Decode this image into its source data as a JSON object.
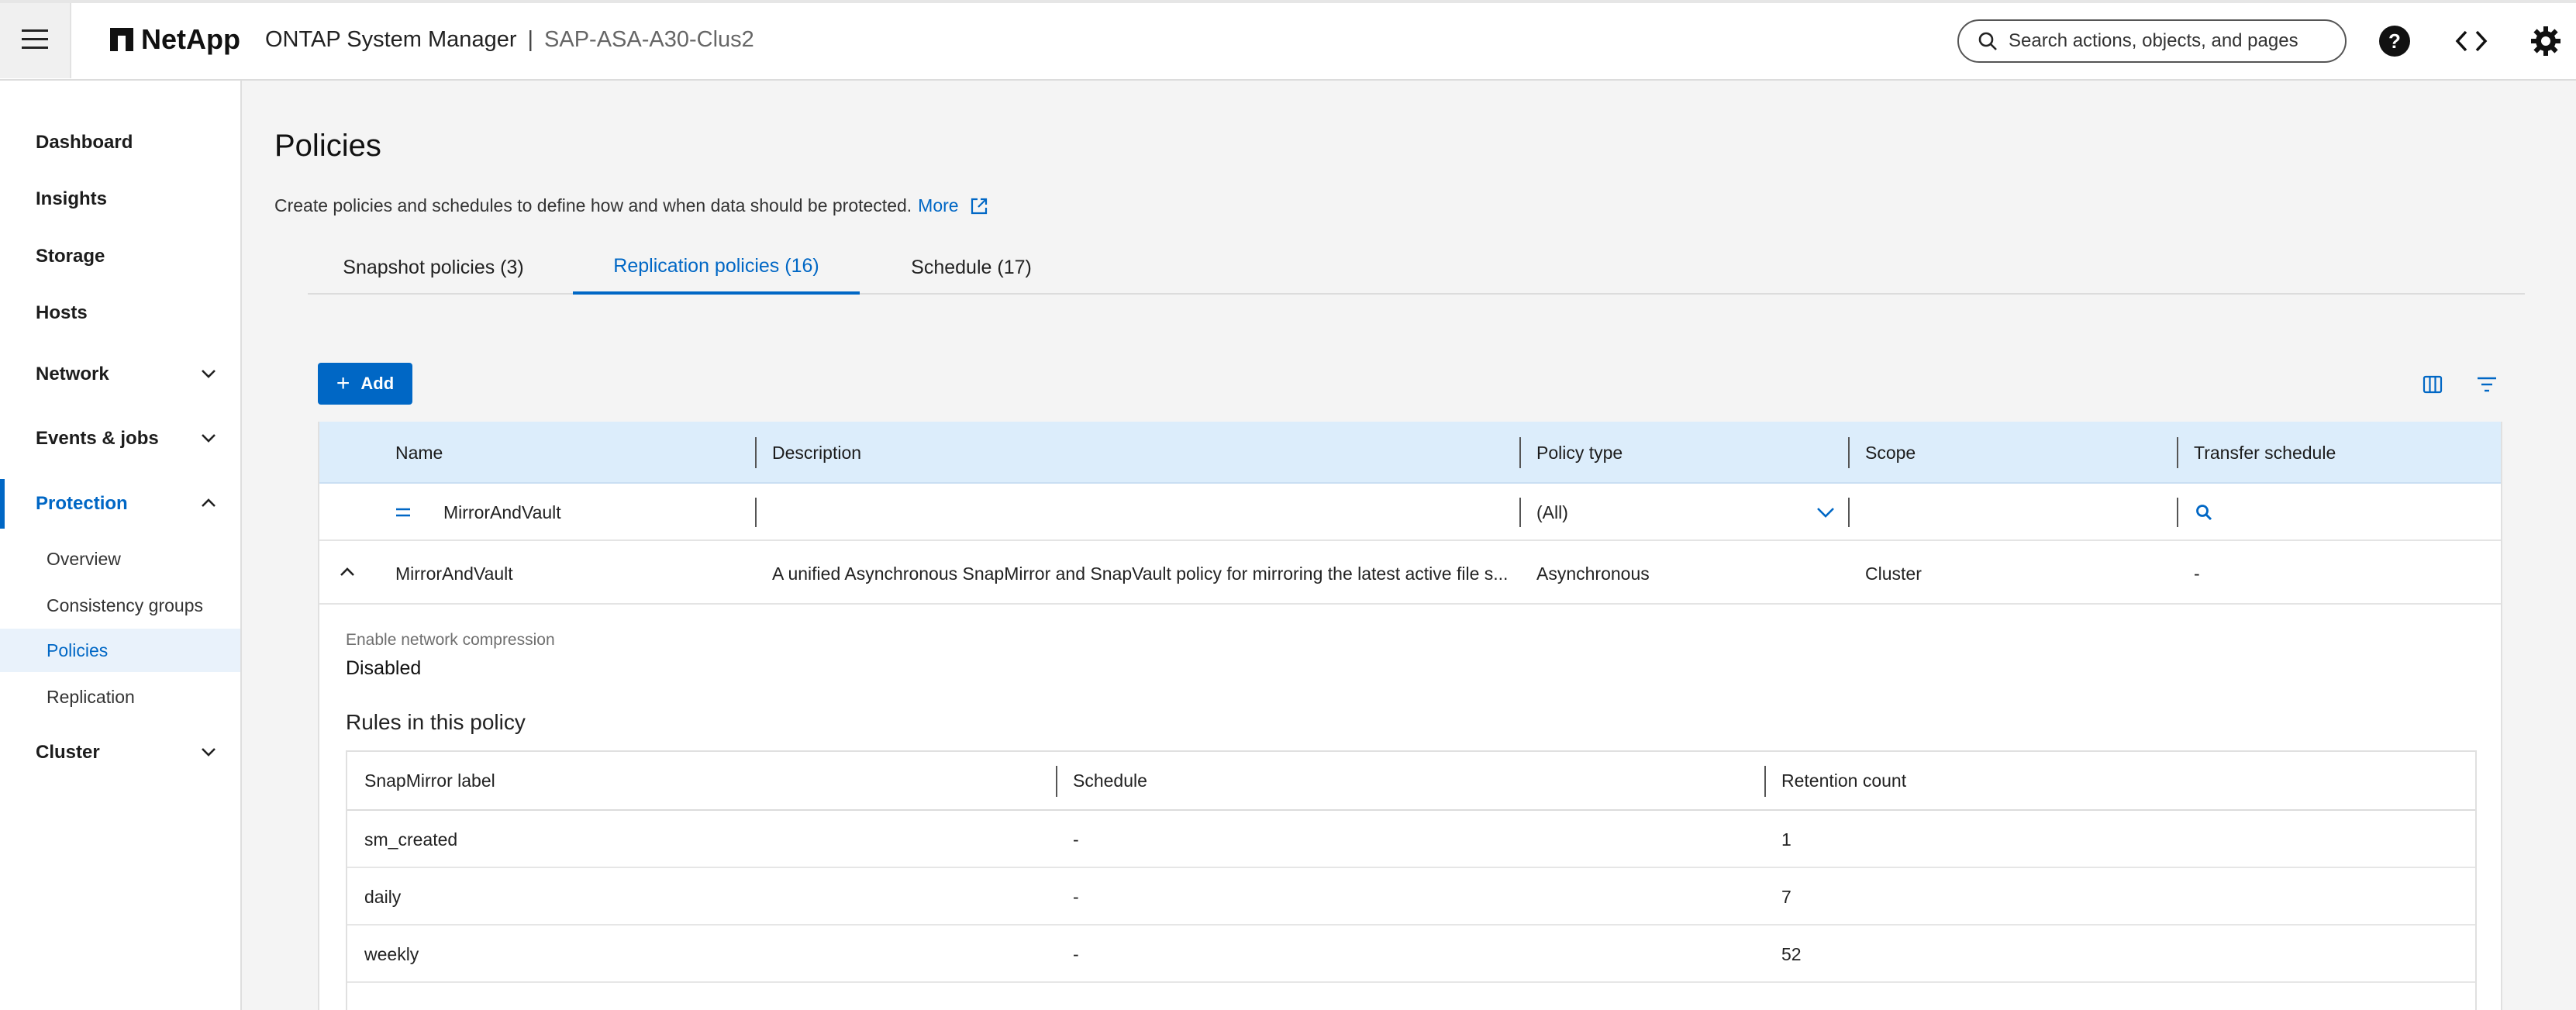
{
  "header": {
    "brand": "NetApp",
    "app_title": "ONTAP System Manager",
    "separator": "|",
    "cluster": "SAP-ASA-A30-Clus2",
    "search_placeholder": "Search actions, objects, and pages",
    "icons": [
      "hamburger-icon",
      "help-icon",
      "code-icon",
      "settings-icon"
    ]
  },
  "sidebar": {
    "items": [
      {
        "label": "Dashboard"
      },
      {
        "label": "Insights"
      },
      {
        "label": "Storage"
      },
      {
        "label": "Hosts"
      },
      {
        "label": "Network",
        "expandable": true
      },
      {
        "label": "Events & jobs",
        "expandable": true
      },
      {
        "label": "Protection",
        "expandable": true,
        "expanded": true,
        "active": true
      },
      {
        "label": "Cluster",
        "expandable": true
      }
    ],
    "protection_sub": [
      {
        "label": "Overview"
      },
      {
        "label": "Consistency groups"
      },
      {
        "label": "Policies",
        "active": true
      },
      {
        "label": "Replication"
      }
    ]
  },
  "page": {
    "title": "Policies",
    "description": "Create policies and schedules to define how and when data should be protected.",
    "more_link": "More"
  },
  "tabs": [
    {
      "label": "Snapshot policies (3)"
    },
    {
      "label": "Replication policies (16)",
      "active": true
    },
    {
      "label": "Schedule (17)"
    }
  ],
  "toolbar": {
    "add_label": "Add"
  },
  "grid": {
    "columns": [
      "Name",
      "Description",
      "Policy type",
      "Scope",
      "Transfer schedule"
    ],
    "filters": {
      "name_operator": "=",
      "name_value": "MirrorAndVault",
      "policy_type": "(All)"
    },
    "rows": [
      {
        "name": "MirrorAndVault",
        "description": "A unified Asynchronous SnapMirror and SnapVault policy for mirroring the latest active file s...",
        "policy_type": "Asynchronous",
        "scope": "Cluster",
        "transfer_schedule": "-"
      }
    ]
  },
  "details": {
    "compression_label": "Enable network compression",
    "compression_value": "Disabled",
    "rules_title": "Rules in this policy",
    "rules_columns": [
      "SnapMirror label",
      "Schedule",
      "Retention count"
    ],
    "rules": [
      {
        "label": "sm_created",
        "schedule": "-",
        "retention": "1"
      },
      {
        "label": "daily",
        "schedule": "-",
        "retention": "7"
      },
      {
        "label": "weekly",
        "schedule": "-",
        "retention": "52"
      }
    ]
  },
  "colors": {
    "accent": "#0067c5",
    "grid_header": "#dcedfb",
    "selected_nav_bg": "#e9f2fb"
  }
}
